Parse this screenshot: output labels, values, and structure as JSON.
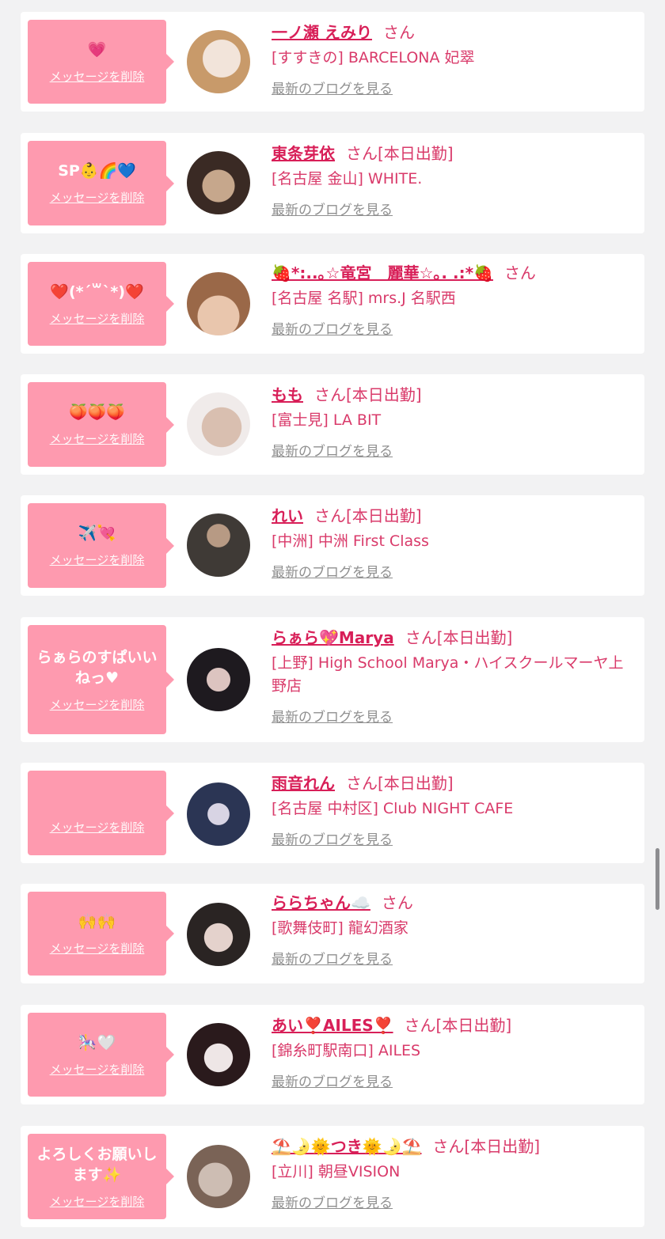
{
  "delete_label": "メッセージを削除",
  "blog_label": "最新のブログを見る",
  "san_label": "さん",
  "items": [
    {
      "bubble": "💗",
      "name": "一ノ瀬 えみり",
      "attendance": "",
      "shop": "[すすきの] BARCELONA 妃翠",
      "avatar_colors": [
        "#f2e4da",
        "#c89a6a"
      ]
    },
    {
      "bubble": "SP👶🌈💙",
      "name": "東条芽依",
      "attendance": "[本日出勤]",
      "shop": "[名古屋 金山] WHITE.",
      "avatar_colors": [
        "#3a2a24",
        "#c6a78c"
      ]
    },
    {
      "bubble": "❤️(*´꒳`*)❤️",
      "name": "🍓*:..｡☆竜宮　麗華☆｡. .:*🍓",
      "attendance": "",
      "shop": "[名古屋 名駅] mrs.J 名駅西",
      "avatar_colors": [
        "#9a6848",
        "#e9c6ad"
      ]
    },
    {
      "bubble": "🍑🍑🍑",
      "name": "もも",
      "attendance": "[本日出勤]",
      "shop": "[富士見] LA BIT",
      "avatar_colors": [
        "#f0ebea",
        "#d9bfb0"
      ]
    },
    {
      "bubble": "✈️💘",
      "name": "れい",
      "attendance": "[本日出勤]",
      "shop": "[中洲] 中洲 First Class",
      "avatar_colors": [
        "#3f3a36",
        "#b79a84"
      ]
    },
    {
      "bubble": "らぁらのすぱいいねっ♥",
      "name": "らぁら💖Marya",
      "attendance": "[本日出勤]",
      "shop": "[上野] High School Marya・ハイスクールマーヤ上野店",
      "avatar_colors": [
        "#1e1a1f",
        "#dcc4c0"
      ]
    },
    {
      "bubble": "",
      "name": "雨音れん",
      "attendance": "[本日出勤]",
      "shop": "[名古屋 中村区] Club NIGHT CAFE",
      "avatar_colors": [
        "#2b3554",
        "#d8d4e4"
      ]
    },
    {
      "bubble": "🙌🙌",
      "name": "ららちゃん☁️",
      "attendance": "",
      "shop": "[歌舞伎町] 龍幻酒家",
      "avatar_colors": [
        "#2a2423",
        "#e4d2cc"
      ]
    },
    {
      "bubble": "🎠🤍",
      "name": "あい❣️AILES❣️",
      "attendance": "[本日出勤]",
      "shop": "[錦糸町駅南口] AILES",
      "avatar_colors": [
        "#2a1a1c",
        "#eee6e6"
      ]
    },
    {
      "bubble": "よろしくお願いします✨",
      "name": "⛱️🌛🌞つき🌞🌛⛱️",
      "attendance": "[本日出勤]",
      "shop": "[立川] 朝昼VISION",
      "avatar_colors": [
        "#7a6356",
        "#cdbdb3"
      ]
    }
  ]
}
